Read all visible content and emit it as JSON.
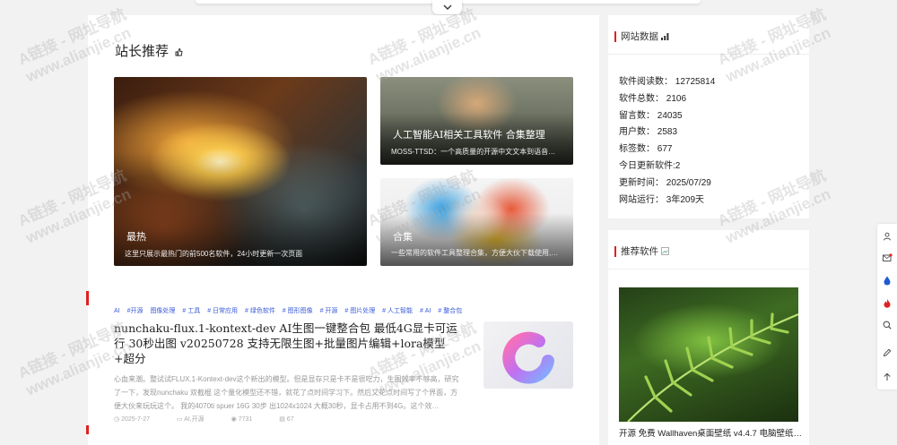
{
  "main": {
    "title": "站长推荐",
    "title_icon": "thumbs-up-icon",
    "cards": [
      {
        "title": "最热",
        "desc": "这里只展示最热门的前500名软件，24小时更新一次页面"
      },
      {
        "title": "人工智能AI相关工具软件 合集整理",
        "desc": "MOSS-TTSD：一个高质量的开源中文文本到语音合成…"
      },
      {
        "title": "合集",
        "desc": "一些常用的软件工具整理合集，方便大伙下载使用,想…"
      }
    ]
  },
  "post": {
    "tags": [
      "AI",
      "#开源",
      "图像处理",
      "# 工具",
      "# 日常应用",
      "# 绿色软件",
      "# 图形图像",
      "# 开源",
      "# 图片处理",
      "# 人工智能",
      "# AI",
      "# 整合包"
    ],
    "title": "nunchaku-flux.1-kontext-dev AI生图一键整合包 最低4G显卡可运行 30秒出图 v20250728 支持无限生图+批量图片编辑+lora模型+超分",
    "body": "心血来潮。整试试FLUX.1-Kontext-dev这个新出的模型。但是显存只是卡不是很吃力，生图效率不够高，研究了一下，发现nunchaku 双截棍 这个量化模型还不错，就花了点时间学习下。然后又花点时间写了个界面，方便大伙来玩玩这个。 我的4070ti spuer 16G 30步 出1024x1024 大概30秒，显卡占用不到4G。这个效…",
    "meta": {
      "date": "2025-7-27",
      "category": "AI,开源",
      "views": "7731",
      "comments": "67"
    }
  },
  "stats": {
    "heading": "网站数据",
    "heading_icon": "signal-icon",
    "items": [
      "软件阅读数： 12725814",
      "软件总数： 2106",
      "留言数： 24035",
      "用户数： 2583",
      "标签数： 677",
      "今日更新软件:2",
      "更新时间： 2025/07/29",
      "网站运行： 3年209天"
    ]
  },
  "recommend": {
    "heading": "推荐软件",
    "caption": "开源 免费 Wallhaven桌面壁纸 v4.4.7 电脑壁纸…"
  },
  "watermark": {
    "line1": "A链接 - 网址导航",
    "line2": "www.alianjie.cn"
  },
  "floating_toolbar": [
    "user-icon",
    "mail-icon",
    "drop-icon",
    "fire-icon",
    "search-icon",
    "edit-icon",
    "arrow-up-icon"
  ],
  "colors": {
    "accent_red": "#e02020",
    "tag_blue": "#3a5bd9"
  }
}
